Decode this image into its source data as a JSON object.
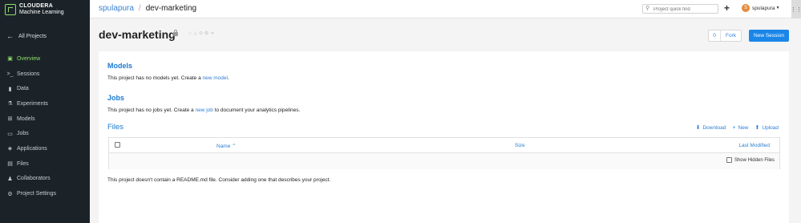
{
  "brand": {
    "line1": "CLOUDERA",
    "line2": "Machine Learning"
  },
  "sidebar": {
    "all_projects": "All Projects",
    "items": [
      {
        "label": "Overview",
        "icon": "overview-icon",
        "glyph": "▣",
        "active": true
      },
      {
        "label": "Sessions",
        "icon": "terminal-icon",
        "glyph": ">_",
        "active": false
      },
      {
        "label": "Data",
        "icon": "bar-chart-icon",
        "glyph": "▮",
        "active": false
      },
      {
        "label": "Experiments",
        "icon": "flask-icon",
        "glyph": "⚗",
        "active": false
      },
      {
        "label": "Models",
        "icon": "models-icon",
        "glyph": "⊞",
        "active": false
      },
      {
        "label": "Jobs",
        "icon": "jobs-icon",
        "glyph": "▭",
        "active": false
      },
      {
        "label": "Applications",
        "icon": "applications-icon",
        "glyph": "◈",
        "active": false
      },
      {
        "label": "Files",
        "icon": "files-icon",
        "glyph": "▤",
        "active": false
      },
      {
        "label": "Collaborators",
        "icon": "collaborators-icon",
        "glyph": "♟",
        "active": false
      },
      {
        "label": "Project Settings",
        "icon": "gear-icon",
        "glyph": "⚙",
        "active": false
      }
    ]
  },
  "topbar": {
    "breadcrumb_user": "spulapura",
    "breadcrumb_sep": "/",
    "breadcrumb_project": "dev-marketing",
    "search_placeholder": "Project quick find",
    "username": "spulapura",
    "avatar_initial": "S"
  },
  "header": {
    "title": "dev-marketing",
    "fork_count": "0",
    "fork_label": "Fork",
    "new_session_label": "New Session"
  },
  "models": {
    "heading": "Models",
    "text": "This project has no models yet. Create a ",
    "link": "new model",
    "text_end": "."
  },
  "jobs": {
    "heading": "Jobs",
    "text": "This project has no jobs yet. Create a ",
    "link": "new job",
    "text_end": " to document your analytics pipelines."
  },
  "files": {
    "heading": "Files",
    "actions": {
      "download": "Download",
      "new": "New",
      "upload": "Upload"
    },
    "columns": {
      "name": "Name",
      "size": "Size",
      "last_modified": "Last Modified"
    },
    "show_hidden_label": "Show Hidden Files",
    "readme_note": "This project doesn't contain a README.md file. Consider adding one that describes your project."
  },
  "colors": {
    "accent": "#1a86e8",
    "sidebar_bg": "#1b2329",
    "active_nav": "#8fdc6a",
    "link": "#2e7fd4"
  }
}
